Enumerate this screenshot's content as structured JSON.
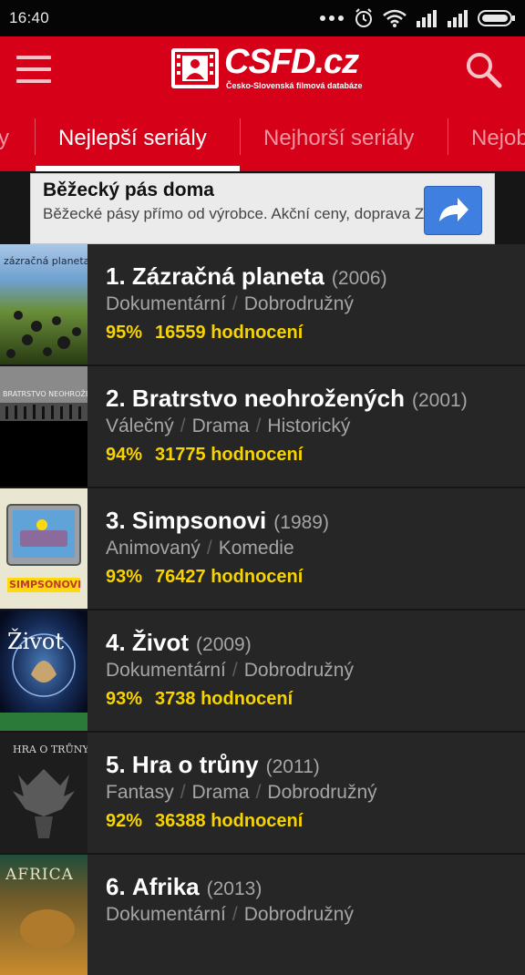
{
  "status_bar": {
    "time": "16:40"
  },
  "app": {
    "logo_text": "CSFD.cz",
    "logo_subtitle": "Česko-Slovenská filmová databáze"
  },
  "tabs": [
    {
      "label": "y"
    },
    {
      "label": "Nejlepší seriály",
      "active": true
    },
    {
      "label": "Nejhorší seriály"
    },
    {
      "label": "Nejob"
    }
  ],
  "ad": {
    "title": "Běžecký pás doma",
    "description": "Běžecké pásy přímo od výrobce. Akční ceny, doprava Z"
  },
  "series": [
    {
      "rank": "1.",
      "title": "Zázračná planeta",
      "year": "(2006)",
      "genres": [
        "Dokumentární",
        "Dobrodružný"
      ],
      "percent": "95%",
      "ratings": "16559 hodnocení",
      "poster_text": "zázračná planeta"
    },
    {
      "rank": "2.",
      "title": "Bratrstvo neohrožených",
      "year": "(2001)",
      "genres": [
        "Válečný",
        "Drama",
        "Historický"
      ],
      "percent": "94%",
      "ratings": "31775 hodnocení",
      "poster_text": "BRATRSTVO NEOHROŽENÝCH"
    },
    {
      "rank": "3.",
      "title": "Simpsonovi",
      "year": "(1989)",
      "genres": [
        "Animovaný",
        "Komedie"
      ],
      "percent": "93%",
      "ratings": "76427 hodnocení",
      "poster_text": "SIMPSONOVI"
    },
    {
      "rank": "4.",
      "title": "Život",
      "year": "(2009)",
      "genres": [
        "Dokumentární",
        "Dobrodružný"
      ],
      "percent": "93%",
      "ratings": "3738 hodnocení",
      "poster_text": "Život"
    },
    {
      "rank": "5.",
      "title": "Hra o trůny",
      "year": "(2011)",
      "genres": [
        "Fantasy",
        "Drama",
        "Dobrodružný"
      ],
      "percent": "92%",
      "ratings": "36388 hodnocení",
      "poster_text": "HRA O TRŮNY"
    },
    {
      "rank": "6.",
      "title": "Afrika",
      "year": "(2013)",
      "genres": [
        "Dokumentární",
        "Dobrodružný"
      ],
      "percent": "",
      "ratings": "",
      "poster_text": "AFRICA"
    }
  ],
  "colors": {
    "brand_red": "#d60019",
    "rating_yellow": "#f7d300",
    "row_bg": "#262626"
  }
}
